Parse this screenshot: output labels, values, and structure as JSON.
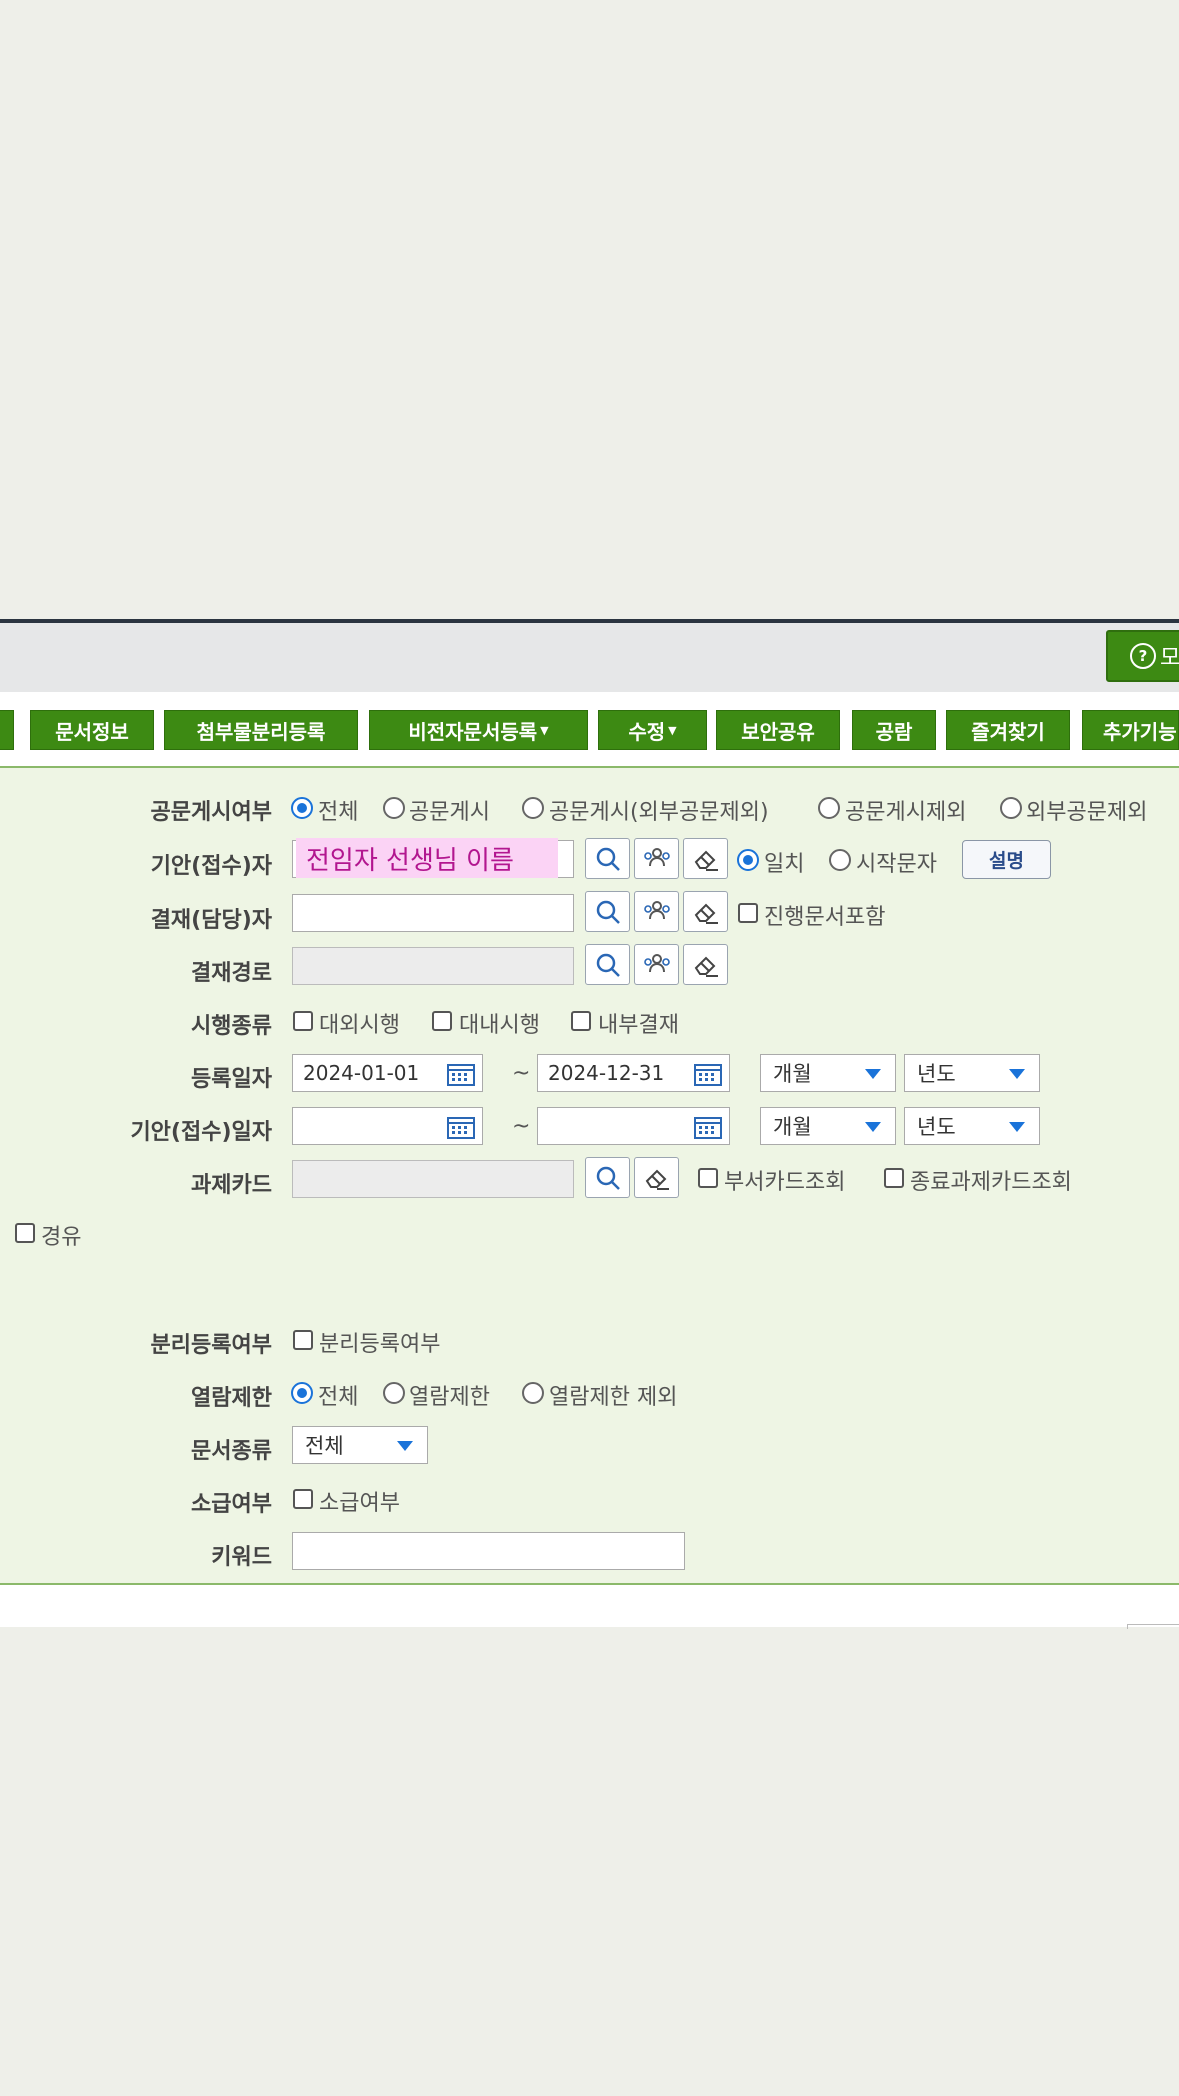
{
  "help": {
    "label": "모"
  },
  "toolbar": {
    "buttons": [
      "문서정보",
      "첨부물분리등록",
      "비전자문서등록",
      "수정",
      "보안공유",
      "공람",
      "즐겨찾기",
      "추가기능"
    ]
  },
  "form": {
    "notice": {
      "label": "공문게시여부",
      "options": [
        "전체",
        "공문게시",
        "공문게시(외부공문제외)",
        "공문게시제외",
        "외부공문제외"
      ],
      "selected": "전체"
    },
    "drafter": {
      "label": "기안(접수)자",
      "value": "전임자 선생님 이름",
      "match_options": [
        "일치",
        "시작문자"
      ],
      "match_selected": "일치",
      "explain_button": "설명"
    },
    "approver": {
      "label": "결재(담당)자",
      "value": "",
      "include_in_progress": "진행문서포함"
    },
    "approval_path": {
      "label": "결재경로",
      "value": ""
    },
    "execution": {
      "label": "시행종류",
      "options": [
        "대외시행",
        "대내시행",
        "내부결재"
      ]
    },
    "reg_date": {
      "label": "등록일자",
      "from": "2024-01-01",
      "to": "2024-12-31",
      "sep": "~",
      "month": "개월",
      "year": "년도"
    },
    "draft_date": {
      "label": "기안(접수)일자",
      "from": "",
      "to": "",
      "sep": "~",
      "month": "개월",
      "year": "년도"
    },
    "task_card": {
      "label": "과제카드",
      "value": "",
      "dept_card": "부서카드조회",
      "closed_card": "종료과제카드조회"
    },
    "via": {
      "label": "경유"
    },
    "separate_reg": {
      "label": "분리등록여부",
      "checkbox": "분리등록여부"
    },
    "view_limit": {
      "label": "열람제한",
      "options": [
        "전체",
        "열람제한",
        "열람제한 제외"
      ],
      "selected": "전체"
    },
    "doc_type": {
      "label": "문서종류",
      "value": "전체"
    },
    "retro": {
      "label": "소급여부",
      "checkbox": "소급여부"
    },
    "keyword": {
      "label": "키워드",
      "value": ""
    }
  }
}
